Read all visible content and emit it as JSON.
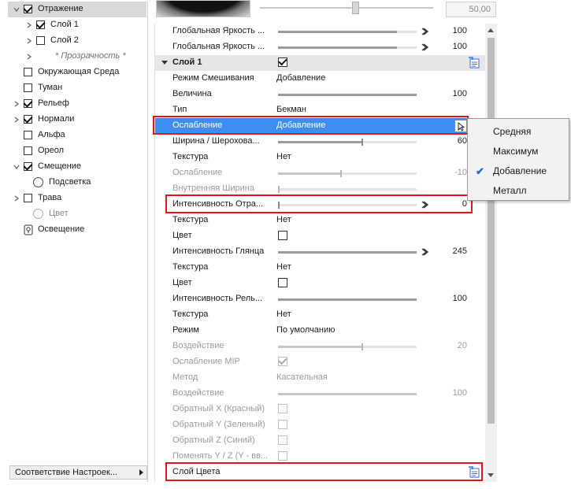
{
  "tree": {
    "items": [
      {
        "label": "Отражение",
        "expander": "open",
        "check": "checked",
        "selected": true
      },
      {
        "label": "Слой 1",
        "expander": "closed",
        "check": "checked"
      },
      {
        "label": "Слой 2",
        "expander": "closed",
        "check": "unchecked"
      },
      {
        "label": "* Прозрачность *",
        "expander": "closed",
        "check": "none",
        "disabled": true
      },
      {
        "label": "Окружающая Среда",
        "check": "unchecked"
      },
      {
        "label": "Туман",
        "check": "unchecked"
      },
      {
        "label": "Рельеф",
        "expander": "closed",
        "check": "checked"
      },
      {
        "label": "Нормали",
        "expander": "closed",
        "check": "checked"
      },
      {
        "label": "Альфа",
        "check": "unchecked"
      },
      {
        "label": "Ореол",
        "check": "unchecked"
      },
      {
        "label": "Смещение",
        "expander": "open",
        "check": "checked"
      },
      {
        "label": "Подсветка",
        "radio": "enabled"
      },
      {
        "label": "Трава",
        "expander": "closed",
        "check": "unchecked"
      },
      {
        "label": "Цвет",
        "radio": "disabled"
      },
      {
        "label": "Освещение",
        "icon": "bulb-icon"
      }
    ],
    "match_settings_label": "Соответствие Настроек..."
  },
  "preview": {
    "value": "50,00",
    "slider_level": 0.55
  },
  "grid": {
    "rows": [
      {
        "type": "slider",
        "label": "Глобальная Яркость ...",
        "value": "100",
        "fill": 0.86,
        "chev": true
      },
      {
        "type": "slider",
        "label": "Глобальная Яркость ...",
        "value": "100",
        "fill": 0.86,
        "chev": true
      },
      {
        "type": "section",
        "label": "Слой 1",
        "checkbox": "checked",
        "link": true
      },
      {
        "type": "text",
        "label": "Режим Смешивания",
        "value": "Добавление"
      },
      {
        "type": "slider",
        "label": "Величина",
        "value": "100",
        "fill": 1.0
      },
      {
        "type": "text",
        "label": "Тип",
        "value": "Бекман"
      },
      {
        "type": "selected",
        "label": "Ослабление",
        "value": "Добавление"
      },
      {
        "type": "slider",
        "label": "Ширина / Шерохова...",
        "value": "60",
        "fill": 0.6,
        "tick": 0.6
      },
      {
        "type": "text",
        "label": "Текстура",
        "value": "Нет"
      },
      {
        "type": "slider",
        "label": "Ослабление",
        "value": "-10",
        "fill": 0.45,
        "tick": 0.45,
        "disabled": true
      },
      {
        "type": "slider",
        "label": "Внутренняя Ширина",
        "value": "",
        "fill": 0.0,
        "tick": 0.0,
        "disabled": true
      },
      {
        "type": "slider",
        "label": "Интенсивность Отра...",
        "value": "0",
        "fill": 0.0,
        "tick": 0.0,
        "chev": true
      },
      {
        "type": "text",
        "label": "Текстура",
        "value": "Нет"
      },
      {
        "type": "check",
        "label": "Цвет",
        "checkbox": "unchecked"
      },
      {
        "type": "slider",
        "label": "Интенсивность Глянца",
        "value": "245",
        "fill": 1.0,
        "chev": true
      },
      {
        "type": "text",
        "label": "Текстура",
        "value": "Нет"
      },
      {
        "type": "check",
        "label": "Цвет",
        "checkbox": "unchecked"
      },
      {
        "type": "slider",
        "label": "Интенсивность Рель...",
        "value": "100",
        "fill": 1.0
      },
      {
        "type": "text",
        "label": "Текстура",
        "value": "Нет"
      },
      {
        "type": "text",
        "label": "Режим",
        "value": "По умолчанию"
      },
      {
        "type": "slider",
        "label": "Воздействие",
        "value": "20",
        "fill": 0.6,
        "tick": 0.6,
        "disabled": true
      },
      {
        "type": "check",
        "label": "Ослабление MIP",
        "checkbox": "checked",
        "disabled": true
      },
      {
        "type": "text",
        "label": "Метод",
        "value": "Касательная",
        "disabled": true
      },
      {
        "type": "slider",
        "label": "Воздействие",
        "value": "100",
        "fill": 1.0,
        "disabled": true
      },
      {
        "type": "check",
        "label": "Обратный X (Красный)",
        "checkbox": "unchecked",
        "disabled": true
      },
      {
        "type": "check",
        "label": "Обратный Y (Зеленый)",
        "checkbox": "unchecked",
        "disabled": true
      },
      {
        "type": "check",
        "label": "Обратный Z (Синий)",
        "checkbox": "unchecked",
        "disabled": true
      },
      {
        "type": "check",
        "label": "Поменять Y / Z (Y - вв...",
        "checkbox": "unchecked",
        "disabled": true
      },
      {
        "type": "link",
        "label": "Слой Цвета"
      }
    ]
  },
  "popup": {
    "items": [
      {
        "label": "Средняя",
        "checked": false
      },
      {
        "label": "Максимум",
        "checked": false
      },
      {
        "label": "Добавление",
        "checked": true
      },
      {
        "label": "Металл",
        "checked": false
      }
    ]
  },
  "colors": {
    "selection": "#3d8ef0",
    "highlight": "#e8141c",
    "check_accent": "#1a6fd4"
  }
}
